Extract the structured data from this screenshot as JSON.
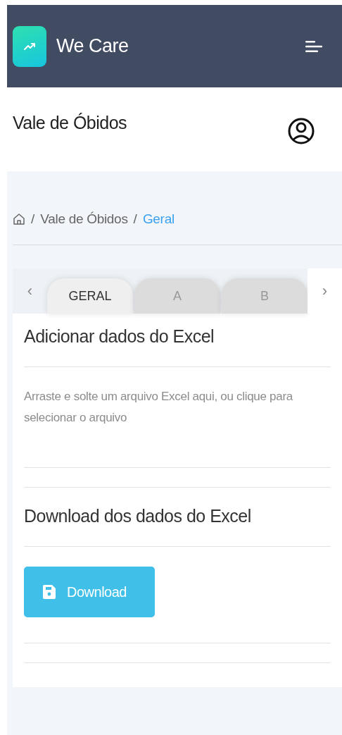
{
  "header": {
    "brand": "We Care"
  },
  "page": {
    "title": "Vale de Óbidos"
  },
  "breadcrumb": [
    {
      "separator": "/",
      "label": "Vale de Óbidos",
      "selected": false
    },
    {
      "separator": "/",
      "label": "Geral",
      "selected": true
    }
  ],
  "tab_nav": {
    "prev": "‹",
    "next": "›"
  },
  "tabs": [
    {
      "label": "GERAL",
      "selected": true
    },
    {
      "label": "A",
      "selected": false
    },
    {
      "label": "B",
      "selected": false
    }
  ],
  "upload": {
    "title": "Adicionar dados do Excel",
    "hint": "Arraste e solte um arquivo Excel aqui, ou clique para selecionar o arquivo"
  },
  "download": {
    "title": "Download dos dados do Excel",
    "button": "Download"
  }
}
